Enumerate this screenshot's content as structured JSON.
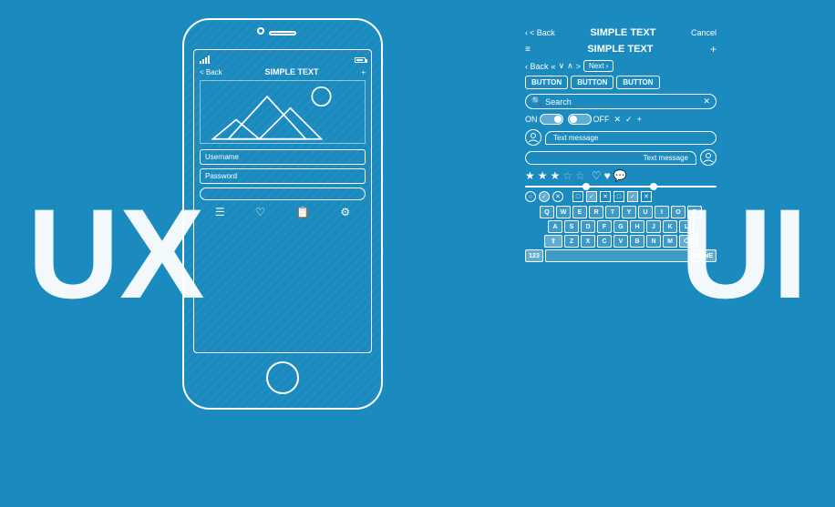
{
  "background_color": "#1a8abf",
  "left_text": {
    "label": "UX"
  },
  "right_text": {
    "label": "UI"
  },
  "phone": {
    "nav_back": "< Back",
    "nav_title": "SIMPLE TEXT",
    "nav_plus": "+",
    "username_placeholder": "Username",
    "password_placeholder": "Password",
    "bottom_icons": [
      "☰",
      "♡",
      "📋",
      "⚙"
    ]
  },
  "ui_panel": {
    "row1": {
      "back": "< Back",
      "title": "SIMPLE TEXT",
      "cancel": "Cancel"
    },
    "row2": {
      "menu": "≡",
      "title": "SIMPLE TEXT",
      "plus": "+"
    },
    "nav_row": {
      "back": "< Back",
      "prev_prev": "«",
      "prev": "∨",
      "next_icon": "∧",
      "next": ">",
      "next_btn": "Next >"
    },
    "buttons": [
      "BUTTON",
      "BUTTON",
      "BUTTON"
    ],
    "search": {
      "placeholder": "Search",
      "clear": "✕"
    },
    "toggles": {
      "on_label": "ON",
      "off_label": "OFF",
      "cross": "✕",
      "check": "✓",
      "plus": "+"
    },
    "chat": {
      "msg1": "Text message",
      "msg2": "Text message"
    },
    "stars": [
      "★",
      "★",
      "★",
      "☆",
      "☆"
    ],
    "hearts": [
      "♡",
      "♥",
      "💬"
    ],
    "keyboard": {
      "rows": [
        [
          "Q",
          "W",
          "E",
          "R",
          "T",
          "Y",
          "U",
          "I",
          "O",
          "P"
        ],
        [
          "A",
          "S",
          "D",
          "F",
          "G",
          "H",
          "J",
          "K",
          "L"
        ],
        [
          "⇧",
          "Z",
          "X",
          "C",
          "V",
          "B",
          "N",
          "M",
          "⌫"
        ],
        [
          "123",
          " ",
          "DONE"
        ]
      ],
      "num_label": "123",
      "done_label": "DONE"
    },
    "checkboxes": {
      "circles": [
        "○",
        "☑",
        "✕",
        "○",
        "☑",
        "✕"
      ],
      "squares": [
        "□",
        "☑",
        "✕"
      ]
    }
  }
}
